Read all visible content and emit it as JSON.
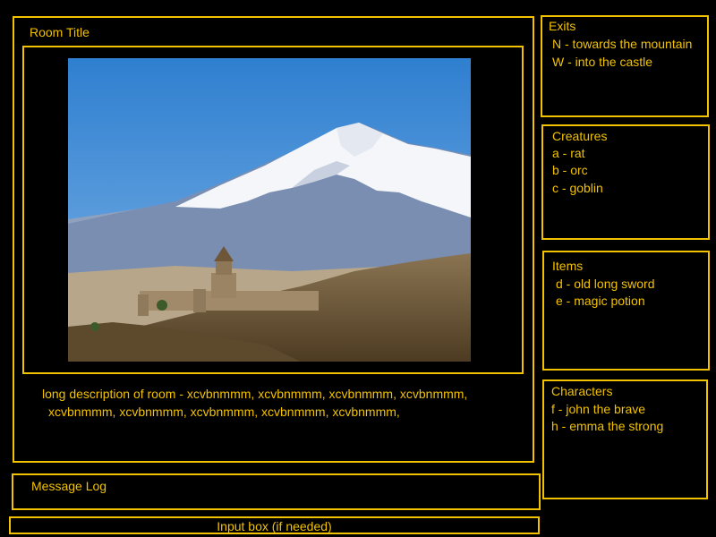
{
  "room": {
    "title": "Room Title",
    "description_line1": "long description of room - xcvbnmmm, xcvbnmmm,  xcvbnmmm,  xcvbnmmm,",
    "description_line2": "xcvbnmmm, xcvbnmmm,  xcvbnmmm,  xcvbnmmm,  xcvbnmmm,"
  },
  "exits": {
    "title": "Exits",
    "items": [
      "N - towards the mountain",
      "W - into the castle"
    ]
  },
  "creatures": {
    "title": "Creatures",
    "items": [
      "a - rat",
      "b - orc",
      "c - goblin"
    ]
  },
  "items": {
    "title": "Items",
    "items": [
      "d - old long sword",
      "e - magic potion"
    ]
  },
  "characters": {
    "title": "Characters",
    "items": [
      "f - john the brave",
      "h - emma the strong"
    ]
  },
  "message_log": {
    "title": "Message Log"
  },
  "input": {
    "placeholder": "Input box (if needed)"
  },
  "colors": {
    "accent": "#f2c200",
    "background": "#000000"
  }
}
